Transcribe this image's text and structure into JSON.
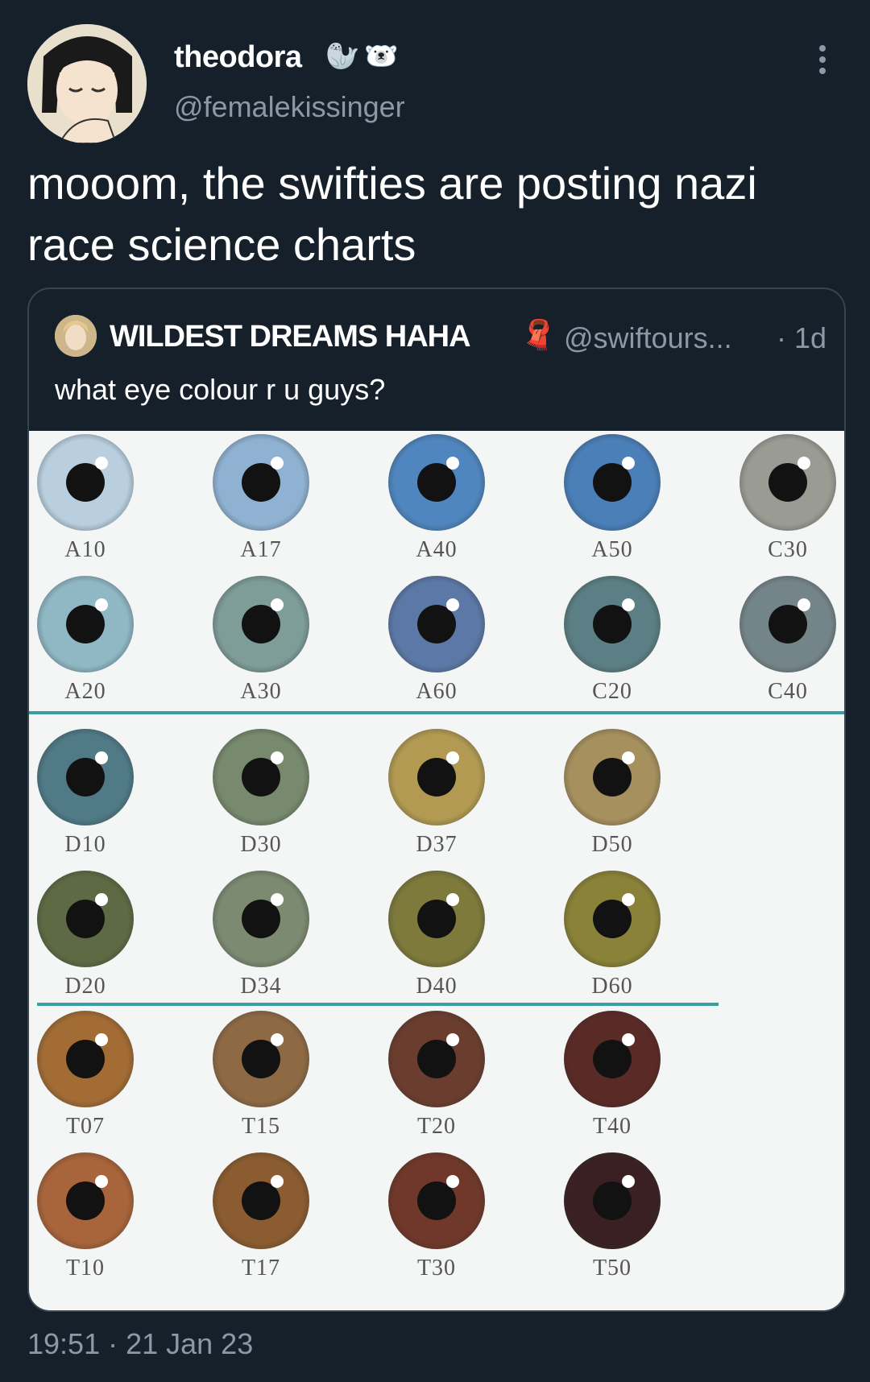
{
  "tweet": {
    "display_name": "theodora",
    "badge_emojis": [
      "🦭",
      "🐻‍❄️"
    ],
    "handle": "@femalekissinger",
    "text": "mooom, the swifties are posting nazi race science charts",
    "timestamp": "19:51 · 21 Jan 23"
  },
  "quoted_tweet": {
    "display_name": "WILDEST DREAMS HAHA",
    "emoji": "🧣",
    "handle": "@swiftours...",
    "time": "· 1d",
    "text": "what eye colour r u guys?"
  },
  "eye_chart": {
    "rows": [
      [
        {
          "label": "A10",
          "color": "#b9cfdf"
        },
        {
          "label": "A17",
          "color": "#8fb2d2"
        },
        {
          "label": "A40",
          "color": "#4f86bf"
        },
        {
          "label": "A50",
          "color": "#4a7fb8"
        },
        {
          "label": "C30",
          "color": "#9a9c94"
        }
      ],
      [
        {
          "label": "A20",
          "color": "#8fb8c4"
        },
        {
          "label": "A30",
          "color": "#7e9c98"
        },
        {
          "label": "A60",
          "color": "#5c78a6"
        },
        {
          "label": "C20",
          "color": "#5b7f84"
        },
        {
          "label": "C40",
          "color": "#74858a"
        }
      ],
      [
        {
          "label": "D10",
          "color": "#4f7a86"
        },
        {
          "label": "D30",
          "color": "#778a6e"
        },
        {
          "label": "D37",
          "color": "#b29a52"
        },
        {
          "label": "D50",
          "color": "#a6905e"
        }
      ],
      [
        {
          "label": "D20",
          "color": "#5e6a44"
        },
        {
          "label": "D34",
          "color": "#7d8a72"
        },
        {
          "label": "D40",
          "color": "#7d7a3c"
        },
        {
          "label": "D60",
          "color": "#8a8238"
        }
      ],
      [
        {
          "label": "T07",
          "color": "#a26c34"
        },
        {
          "label": "T15",
          "color": "#8e6a44"
        },
        {
          "label": "T20",
          "color": "#6b3d2e"
        },
        {
          "label": "T40",
          "color": "#5a2a26"
        }
      ],
      [
        {
          "label": "T10",
          "color": "#a8643a"
        },
        {
          "label": "T17",
          "color": "#8a5c30"
        },
        {
          "label": "T30",
          "color": "#70382a"
        },
        {
          "label": "T50",
          "color": "#3a2022"
        }
      ]
    ],
    "divider_color": "#3a9fa2"
  }
}
